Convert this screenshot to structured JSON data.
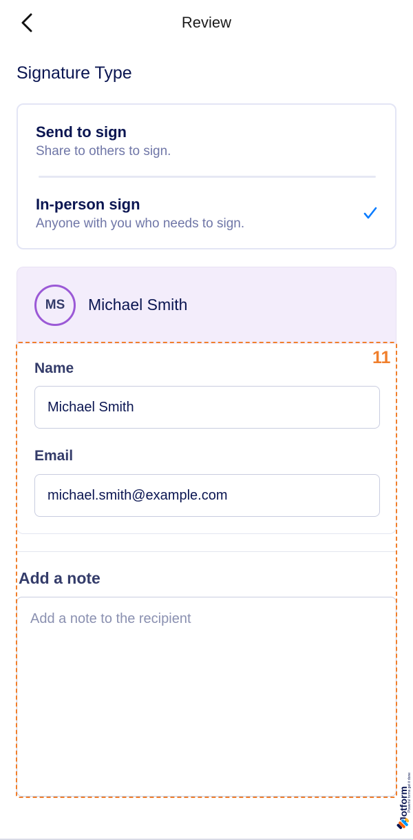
{
  "header": {
    "title": "Review",
    "back_icon": "chevron-left-icon"
  },
  "signature_type": {
    "title": "Signature Type",
    "options": [
      {
        "title": "Send to sign",
        "description": "Share to others to sign.",
        "selected": false
      },
      {
        "title": "In-person sign",
        "description": "Anyone with you who needs to sign.",
        "selected": true
      }
    ]
  },
  "signer": {
    "initials": "MS",
    "name": "Michael Smith",
    "fields": {
      "name_label": "Name",
      "name_value": "Michael Smith",
      "email_label": "Email",
      "email_value": "michael.smith@example.com"
    }
  },
  "note": {
    "label": "Add a note",
    "placeholder": "Add a note to the recipient"
  },
  "annotation": {
    "number": "11",
    "color": "#f07f2c"
  },
  "brand": {
    "name": "Jotform",
    "tagline": "Powerful forms get it done"
  },
  "colors": {
    "accent": "#0a7cff",
    "text": "#0a1551",
    "avatar_ring": "#9b59d6",
    "signer_bg": "#f3edfb"
  }
}
